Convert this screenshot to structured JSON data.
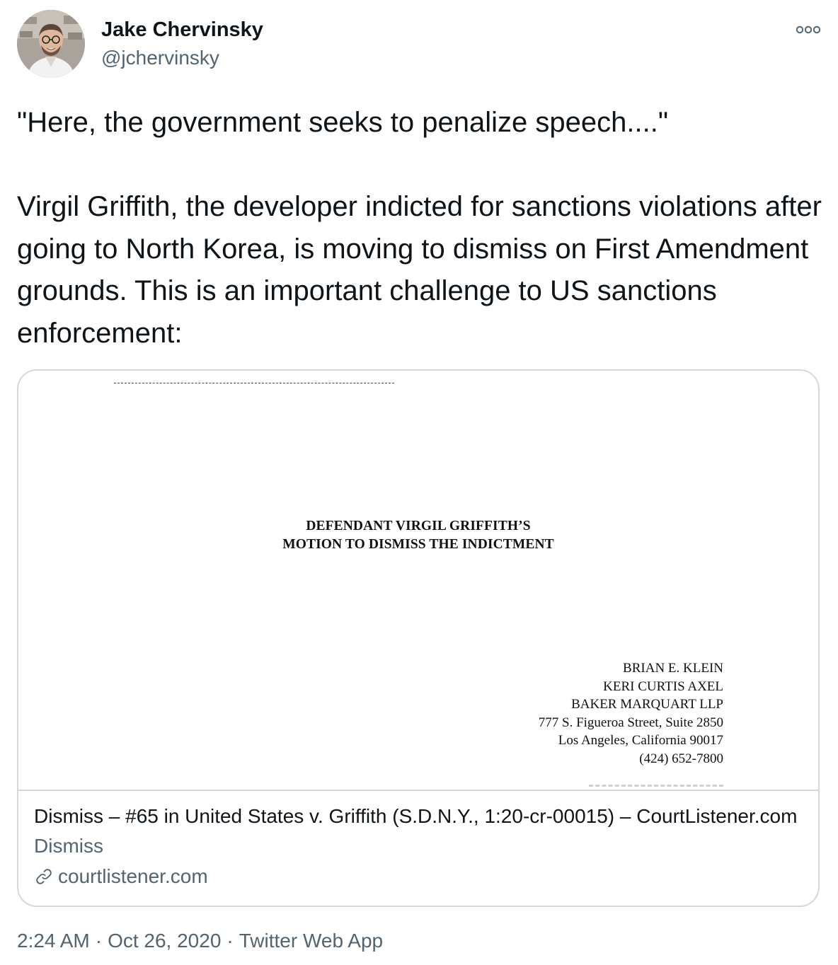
{
  "author": {
    "name": "Jake Chervinsky",
    "handle": "@jchervinsky"
  },
  "tweet": {
    "text": "\"Here, the government seeks to penalize speech....\"\n\nVirgil Griffith, the developer indicted for sanctions violations after going to North Korea, is moving to dismiss on First Amendment grounds. This is an important challenge to US sanctions enforcement:"
  },
  "card": {
    "document": {
      "title_line1": "DEFENDANT VIRGIL GRIFFITH’S",
      "title_line2": "MOTION TO DISMISS THE INDICTMENT",
      "address_lines": [
        "BRIAN E. KLEIN",
        "KERI CURTIS AXEL",
        "BAKER MARQUART LLP",
        "777 S. Figueroa Street, Suite 2850",
        "Los Angeles, California 90017",
        "(424) 652-7800"
      ]
    },
    "title": "Dismiss – #65 in United States v. Griffith (S.D.N.Y., 1:20-cr-00015) – CourtListener.com",
    "description": "Dismiss",
    "domain": "courtlistener.com"
  },
  "meta": {
    "time": "2:24 AM",
    "separator": "·",
    "date": "Oct 26, 2020",
    "app": "Twitter Web App"
  },
  "colors": {
    "text_primary": "#0f1419",
    "text_secondary": "#536471",
    "border": "#cfd9de"
  }
}
